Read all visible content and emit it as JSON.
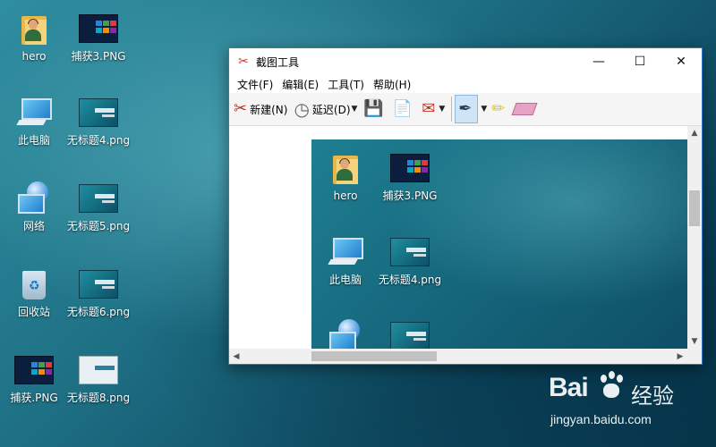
{
  "desktop": {
    "icons": [
      {
        "label": "hero",
        "icon": "user-folder-icon"
      },
      {
        "label": "捕获3.PNG",
        "icon": "png-file-icon"
      },
      {
        "label": "此电脑",
        "icon": "this-pc-icon"
      },
      {
        "label": "无标题4.png",
        "icon": "png-file-icon"
      },
      {
        "label": "网络",
        "icon": "network-icon"
      },
      {
        "label": "无标题5.png",
        "icon": "png-file-icon"
      },
      {
        "label": "回收站",
        "icon": "recycle-bin-icon"
      },
      {
        "label": "无标题6.png",
        "icon": "png-file-icon"
      },
      {
        "label": "捕获.PNG",
        "icon": "png-file-icon"
      },
      {
        "label": "无标题8.png",
        "icon": "png-file-icon"
      }
    ]
  },
  "window": {
    "title": "截图工具",
    "controls": {
      "minimize": "—",
      "maximize": "☐",
      "close": "✕"
    },
    "menu": [
      "文件(F)",
      "编辑(E)",
      "工具(T)",
      "帮助(H)"
    ],
    "toolbar": {
      "new_label": "新建(N)",
      "delay_label": "延迟(D)"
    },
    "captured": {
      "icons": [
        {
          "label": "hero"
        },
        {
          "label": "捕获3.PNG"
        },
        {
          "label": "此电脑"
        },
        {
          "label": "无标题4.png"
        }
      ]
    }
  },
  "watermark": {
    "brand": "Bai",
    "cn": "经验",
    "url": "jingyan.baidu.com"
  }
}
